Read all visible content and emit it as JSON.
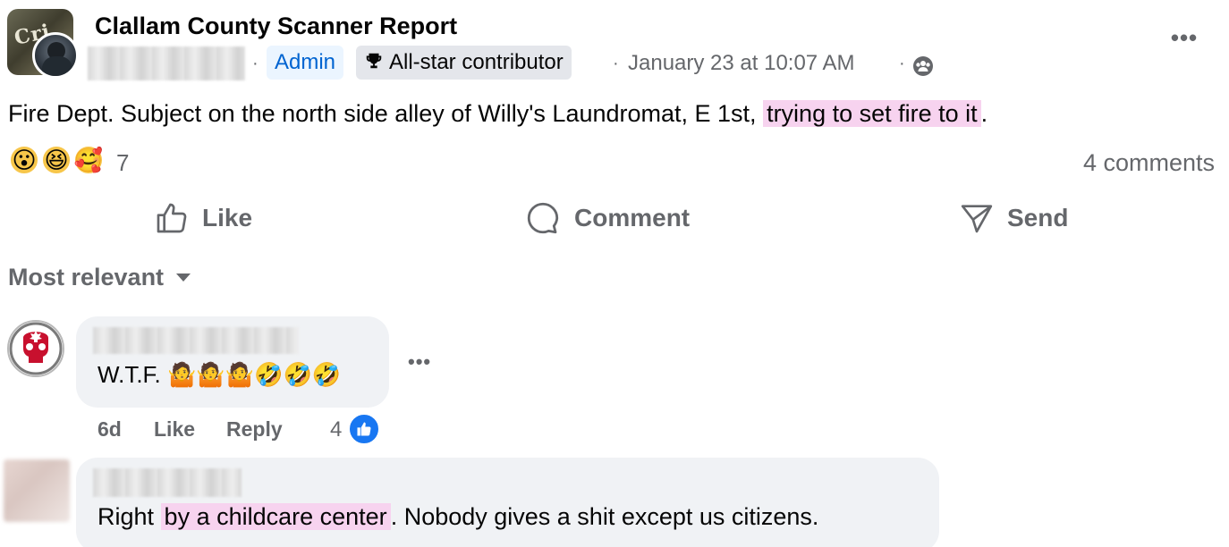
{
  "post": {
    "group_name": "Clallam County Scanner Report",
    "group_avatar_text": "Cri",
    "badge_admin": "Admin",
    "badge_allstar": "All-star contributor",
    "timestamp": "January 23 at 10:07 AM",
    "separator": "·",
    "audience_icon": "group-members-icon",
    "more_icon": "•••",
    "text_before": "Fire Dept. Subject on the north side alley of Willy's Laundromat,  E 1st, ",
    "text_highlight": "trying to set fire to it",
    "text_after": ".",
    "reactions": [
      "😮",
      "😆",
      "🥰"
    ],
    "reaction_count": "7",
    "comments_count": "4 comments"
  },
  "actions": {
    "like": "Like",
    "comment": "Comment",
    "send": "Send"
  },
  "sort": {
    "label": "Most relevant"
  },
  "comments": [
    {
      "text": "W.T.F. 🤷🤷🤷🤣🤣🤣",
      "age": "6d",
      "like": "Like",
      "reply": "Reply",
      "like_count": "4",
      "more_icon": "•••"
    },
    {
      "text_before": "Right ",
      "text_highlight": "by a childcare center",
      "text_after": ". Nobody gives a shit except us citizens."
    }
  ],
  "colors": {
    "highlight": "#f7d3ef",
    "secondary_text": "#65676b",
    "bubble": "#f0f2f5",
    "admin_blue": "#0064d1",
    "like_blue": "#1877f2"
  }
}
